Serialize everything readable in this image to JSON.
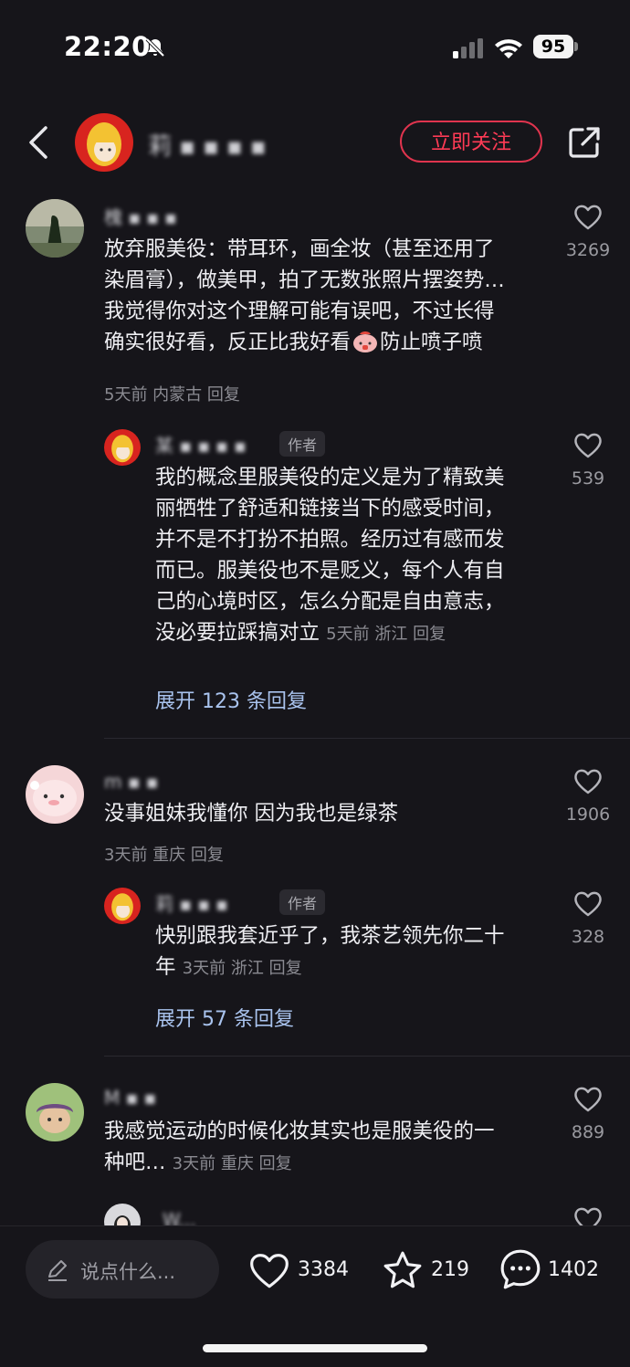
{
  "status": {
    "time": "22:20",
    "battery": "95"
  },
  "header": {
    "follow_label": "立即关注",
    "name_obscured": "莉 ▪ ▪ ▪ ▪"
  },
  "comments": [
    {
      "name_obscured": "槐 ▪ ▪ ▪",
      "text_lines": [
        "放弃服美役：带耳环，画全妆（甚至还用了",
        "染眉膏），做美甲，拍了无数张照片摆姿势…",
        "我觉得你对这个理解可能有误吧，不过长得",
        "确实很好看，反正比我好看"
      ],
      "text_tail": "防止喷子喷",
      "meta": "5天前 内蒙古 回复",
      "likes": "3269",
      "reply": {
        "name_obscured": "某 ▪ ▪ ▪ ▪",
        "tag": "作者",
        "text_lines": [
          "我的概念里服美役的定义是为了精致美",
          "丽牺牲了舒适和链接当下的感受时间，",
          "并不是不打扮不拍照。经历过有感而发",
          "而已。服美役也不是贬义，每个人有自",
          "己的心境时区，怎么分配是自由意志，",
          "没必要拉踩搞对立"
        ],
        "meta": "5天前 浙江 回复",
        "likes": "539"
      },
      "expand": "展开 123 条回复"
    },
    {
      "name_obscured": "m ▪ ▪",
      "text_lines": [
        "没事姐妹我懂你  因为我也是绿茶"
      ],
      "meta": "3天前 重庆 回复",
      "likes": "1906",
      "reply": {
        "name_obscured": "莉 ▪ ▪ ▪",
        "tag": "作者",
        "text_lines": [
          "快别跟我套近乎了，我茶艺领先你二十",
          "年"
        ],
        "meta": "3天前 浙江 回复",
        "likes": "328"
      },
      "expand": "展开 57 条回复"
    },
    {
      "name_obscured": "M ▪ ▪",
      "text_lines": [
        "我感觉运动的时候化妆其实也是服美役的一",
        "种吧…"
      ],
      "meta": "3天前 重庆 回复",
      "likes": "889"
    },
    {
      "name_obscured": "W..."
    }
  ],
  "bottom_bar": {
    "input_placeholder": "说点什么...",
    "likes": "3384",
    "favorites": "219",
    "comments": "1402"
  }
}
